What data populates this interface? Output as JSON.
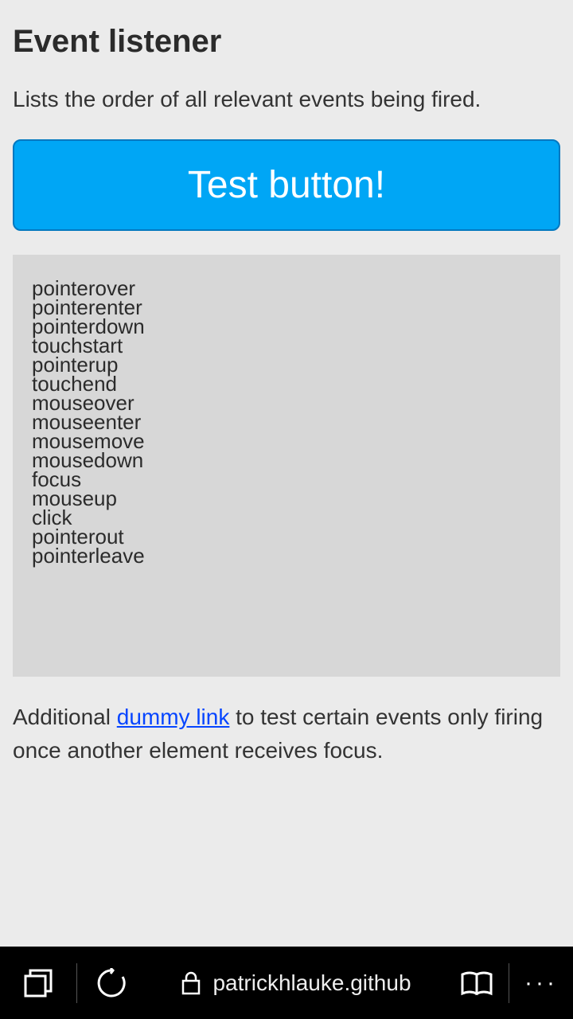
{
  "page": {
    "heading": "Event listener",
    "description": "Lists the order of all relevant events being fired.",
    "test_button_label": "Test button!",
    "events": [
      "pointerover",
      "pointerenter",
      "pointerdown",
      "touchstart",
      "pointerup",
      "touchend",
      "mouseover",
      "mouseenter",
      "mousemove",
      "mousedown",
      "focus",
      "mouseup",
      "click",
      "pointerout",
      "pointerleave"
    ],
    "after_text_prefix": "Additional ",
    "dummy_link_text": "dummy link",
    "after_text_suffix": " to test certain events only firing once another element receives focus."
  },
  "chrome": {
    "address_text": "patrickhlauke.github",
    "more_label": "···"
  }
}
